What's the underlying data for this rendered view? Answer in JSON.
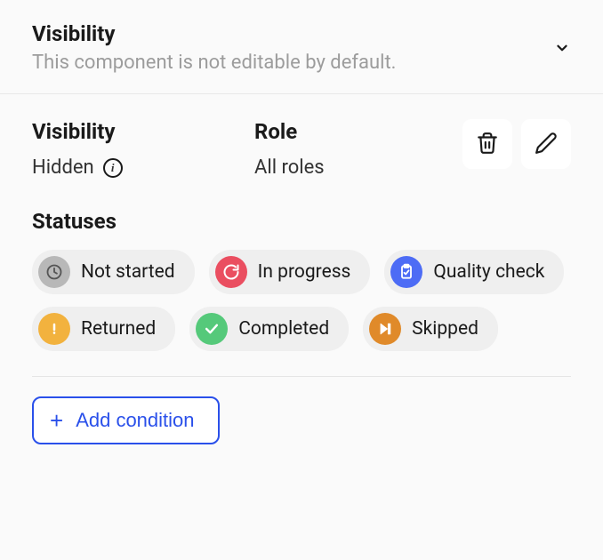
{
  "header": {
    "title": "Visibility",
    "subtitle": "This component is not editable by default."
  },
  "panel": {
    "visibility": {
      "label": "Visibility",
      "value": "Hidden"
    },
    "role": {
      "label": "Role",
      "value": "All roles"
    }
  },
  "statuses": {
    "label": "Statuses",
    "items": [
      {
        "label": "Not started",
        "icon": "clock",
        "color": "#b8b8b8"
      },
      {
        "label": "In progress",
        "icon": "refresh",
        "color": "#ea4e60"
      },
      {
        "label": "Quality check",
        "icon": "clipboard",
        "color": "#4d6cf5"
      },
      {
        "label": "Returned",
        "icon": "alert",
        "color": "#f2b23e"
      },
      {
        "label": "Completed",
        "icon": "check",
        "color": "#55c97a"
      },
      {
        "label": "Skipped",
        "icon": "skip",
        "color": "#e08a2a"
      }
    ]
  },
  "actions": {
    "add_condition": "Add condition"
  }
}
